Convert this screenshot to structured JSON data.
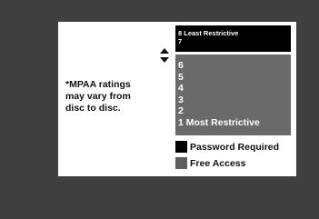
{
  "note": {
    "lines": [
      "*MPAA ratings",
      "may vary from",
      "disc to disc."
    ]
  },
  "ratings": {
    "highlighted": [
      "8 Least Restrictive",
      "7"
    ],
    "levels": [
      "6",
      "5",
      "4",
      "3",
      "2",
      "1 Most Restrictive"
    ]
  },
  "legend": {
    "items": [
      {
        "label": "Password Required",
        "color": "#000000"
      },
      {
        "label": "Free Access",
        "color": "#5f5f5f"
      }
    ]
  },
  "icons": {
    "scroll": "up-down-arrows-icon"
  },
  "colors": {
    "background": "#404040",
    "panel": "#ffffff",
    "locked_list": "#6a6a6a",
    "highlight": "#000000"
  }
}
